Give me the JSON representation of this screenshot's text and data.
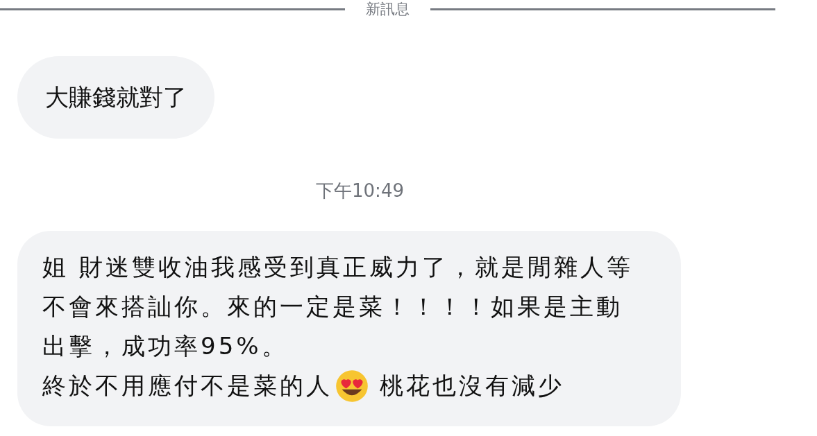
{
  "divider": {
    "label": "新訊息"
  },
  "messages": [
    {
      "kind": "text",
      "paragraphs": [
        {
          "parts": [
            {
              "kind": "text",
              "text": "大賺錢就對了"
            }
          ]
        }
      ]
    },
    {
      "kind": "timestamp",
      "text": "下午10:49"
    },
    {
      "kind": "text",
      "paragraphs": [
        {
          "parts": [
            {
              "kind": "text",
              "text": "姐 財迷雙收油我感受到真正威力了，就是閒雜人等不會來搭訕你。來的一定是菜！！！！如果是主動出擊，成功率95%。"
            }
          ]
        },
        {
          "parts": [
            {
              "kind": "text",
              "text": "終於不用應付不是菜的人"
            },
            {
              "kind": "emoji"
            },
            {
              "kind": "text",
              "text": "桃花也沒有減少"
            }
          ]
        }
      ]
    }
  ]
}
